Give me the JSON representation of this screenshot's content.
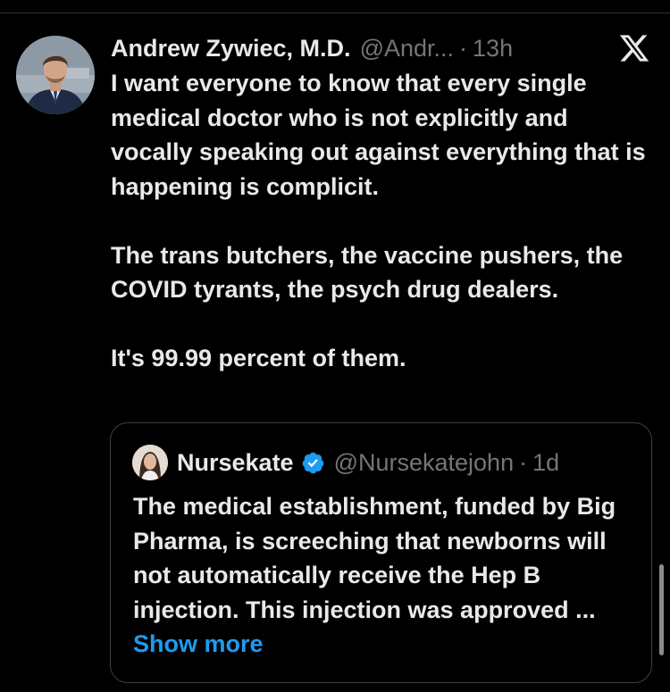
{
  "post": {
    "author_name": "Andrew Zywiec, M.D.",
    "author_handle": "@Andr...",
    "separator": "·",
    "timestamp": "13h",
    "paragraphs": [
      "I want everyone to know that every single medical doctor who is not explicitly and vocally speaking out against everything that is happening is complicit.",
      "The trans butchers, the vaccine pushers, the COVID tyrants, the psych drug dealers.",
      "It's 99.99 percent of them."
    ]
  },
  "quoted_post": {
    "author_name": "Nursekate",
    "author_handle": "@Nursekatejohn",
    "separator": "·",
    "timestamp": "1d",
    "verified": true,
    "text": "The medical establishment, funded by Big Pharma, is screeching that newborns will not automatically receive the Hep B injection. This injection was approved ...",
    "show_more_label": "Show more"
  },
  "icons": {
    "platform_logo": "x-logo-icon",
    "verified_badge": "verified-badge-icon"
  },
  "colors": {
    "background": "#000000",
    "text_primary": "#e7e9ea",
    "text_secondary": "#71767b",
    "link": "#1d9bf0",
    "border": "#3a3f43",
    "verified": "#1d9bf0"
  }
}
